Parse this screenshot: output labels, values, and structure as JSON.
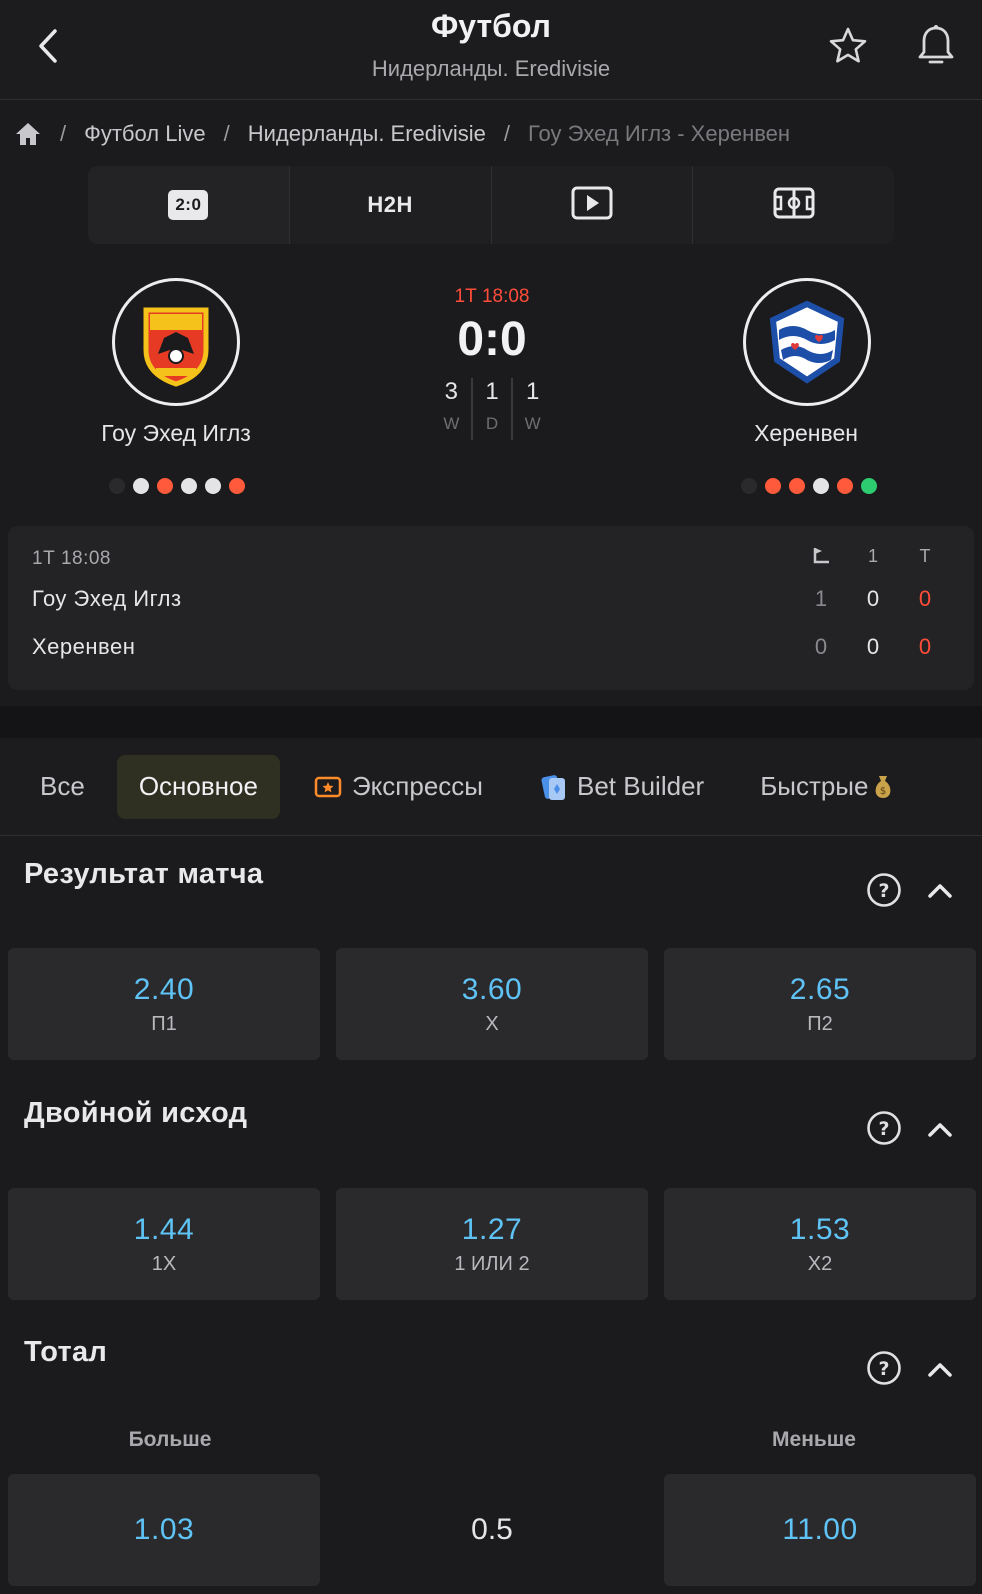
{
  "header": {
    "title": "Футбол",
    "subtitle": "Нидерланды. Eredivisie"
  },
  "breadcrumb": {
    "items": [
      "Футбол Live",
      "Нидерланды. Eredivisie",
      "Гоу Эхед Иглз - Херенвен"
    ]
  },
  "view_tabs": {
    "score_badge": "2:0",
    "h2h": "H2H",
    "icons": [
      "play-icon",
      "field-icon"
    ]
  },
  "match": {
    "period_time": "1Т 18:08",
    "score": "0:0",
    "home": {
      "name": "Гоу Эхед Иглз",
      "form": [
        "none",
        "white",
        "red",
        "white",
        "white",
        "red"
      ]
    },
    "away": {
      "name": "Херенвен",
      "form": [
        "none",
        "red",
        "red",
        "white",
        "red",
        "green"
      ]
    },
    "h2h": [
      {
        "value": "3",
        "label": "W"
      },
      {
        "value": "1",
        "label": "D"
      },
      {
        "value": "1",
        "label": "W"
      }
    ]
  },
  "scoreboard": {
    "time": "1Т 18:08",
    "columns": [
      "1",
      "Т"
    ],
    "rows": [
      {
        "team": "Гоу Эхед Иглз",
        "corners": "1",
        "p1": "0",
        "total": "0"
      },
      {
        "team": "Херенвен",
        "corners": "0",
        "p1": "0",
        "total": "0"
      }
    ]
  },
  "filters": {
    "all": "Все",
    "main": "Основное",
    "express": "Экспрессы",
    "bet_builder": "Bet Builder",
    "fast": "Быстрые"
  },
  "markets": {
    "result": {
      "title": "Результат матча",
      "odds": [
        {
          "value": "2.40",
          "label": "П1"
        },
        {
          "value": "3.60",
          "label": "Х"
        },
        {
          "value": "2.65",
          "label": "П2"
        }
      ]
    },
    "double": {
      "title": "Двойной исход",
      "odds": [
        {
          "value": "1.44",
          "label": "1Х"
        },
        {
          "value": "1.27",
          "label": "1 ИЛИ 2"
        },
        {
          "value": "1.53",
          "label": "Х2"
        }
      ]
    },
    "total": {
      "title": "Тотал",
      "over_label": "Больше",
      "under_label": "Меньше",
      "over": "1.03",
      "line": "0.5",
      "under": "11.00"
    }
  },
  "colors": {
    "accent_odds": "#5fc3f5",
    "live_red": "#ff4d3a",
    "active_chip": "#2f2f22"
  }
}
